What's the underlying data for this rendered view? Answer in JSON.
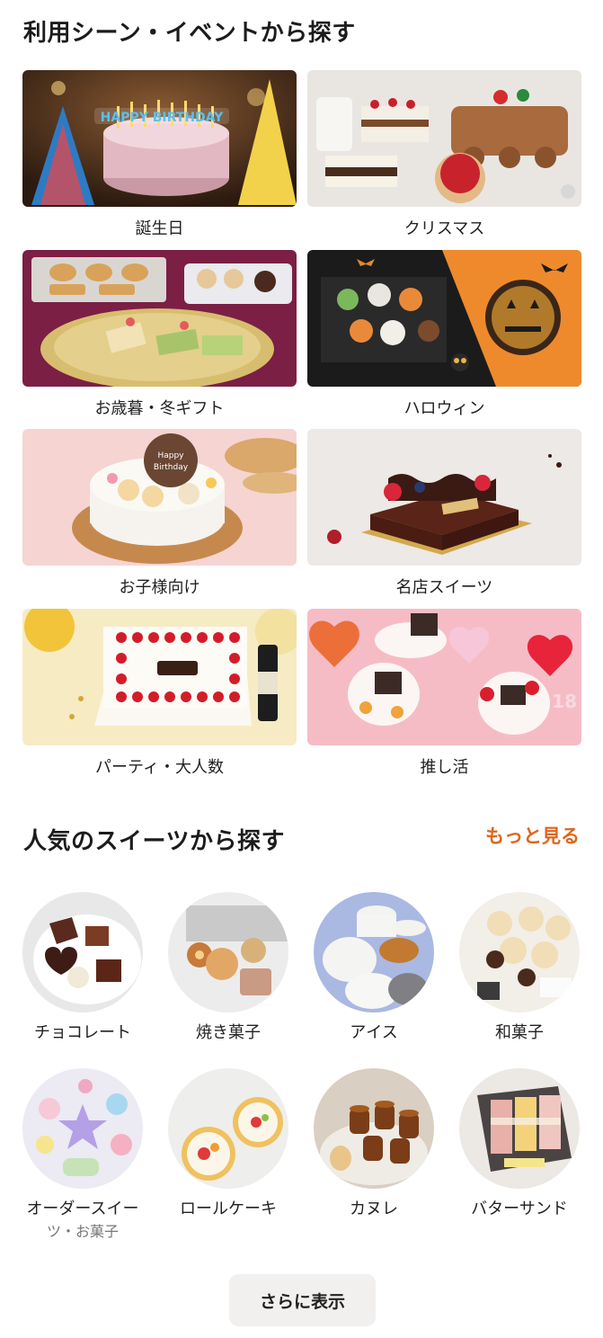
{
  "scene_section": {
    "title": "利用シーン・イベントから探す",
    "items": [
      {
        "label": "誕生日"
      },
      {
        "label": "クリスマス"
      },
      {
        "label": "お歳暮・冬ギフト"
      },
      {
        "label": "ハロウィン"
      },
      {
        "label": "お子様向け"
      },
      {
        "label": "名店スイーツ"
      },
      {
        "label": "パーティ・大人数"
      },
      {
        "label": "推し活"
      }
    ]
  },
  "sweets_section": {
    "title": "人気のスイーツから探す",
    "more_label": "もっと見る",
    "items": [
      {
        "label": "チョコレート"
      },
      {
        "label": "焼き菓子"
      },
      {
        "label": "アイス"
      },
      {
        "label": "和菓子"
      },
      {
        "label": "オーダースイー",
        "label_cont": "ツ・お菓子"
      },
      {
        "label": "ロールケーキ"
      },
      {
        "label": "カヌレ"
      },
      {
        "label": "バターサンド"
      }
    ]
  },
  "show_more_button": {
    "label": "さらに表示"
  },
  "colors": {
    "accent": "#e0651b",
    "button_bg": "#f1f0ee",
    "text": "#222222"
  }
}
